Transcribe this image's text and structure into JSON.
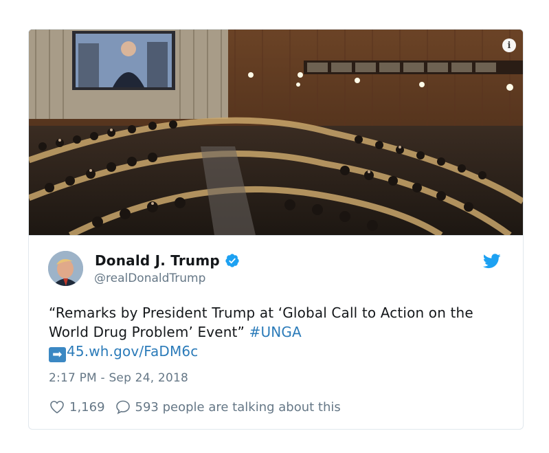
{
  "photo": {
    "alt_icon": "i",
    "description_icon": "info-icon"
  },
  "user": {
    "name": "Donald J. Trump",
    "handle": "@realDonaldTrump",
    "verified": true,
    "avatar_icon": "avatar"
  },
  "tweet": {
    "text_part1": "“Remarks by President Trump at ‘Global Call to Action on the World Drug Problem’ Event” ",
    "hashtag": "#UNGA",
    "arrow": "➡",
    "link": "45.wh.gov/FaDM6c",
    "timestamp": "2:17 PM - Sep 24, 2018"
  },
  "actions": {
    "likes": "1,169",
    "talking": "593 people are talking about this"
  },
  "colors": {
    "link": "#2b7bb9",
    "verified": "#1da1f2",
    "muted": "#657786",
    "text": "#14171a"
  }
}
